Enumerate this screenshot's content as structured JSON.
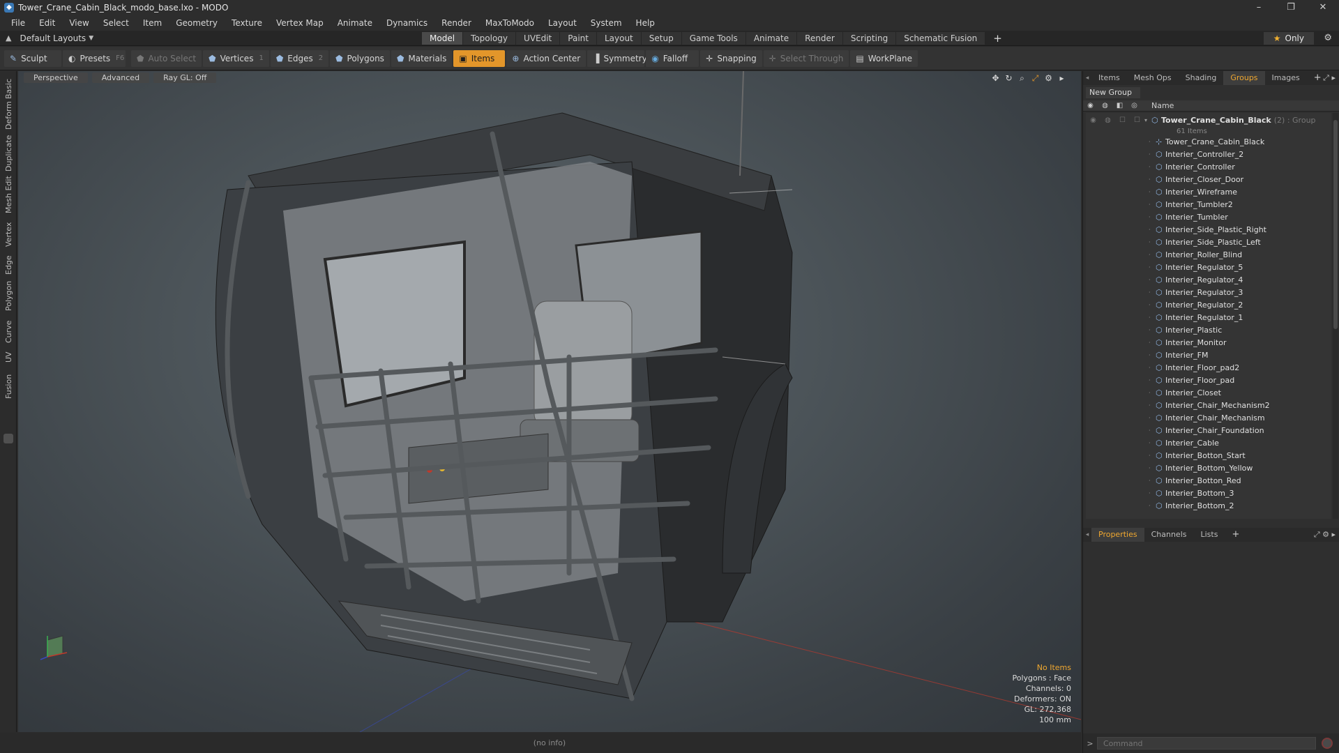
{
  "window": {
    "title": "Tower_Crane_Cabin_Black_modo_base.lxo - MODO",
    "controls": [
      "–",
      "❐",
      "✕"
    ]
  },
  "menu": [
    "File",
    "Edit",
    "View",
    "Select",
    "Item",
    "Geometry",
    "Texture",
    "Vertex Map",
    "Animate",
    "Dynamics",
    "Render",
    "MaxToModo",
    "Layout",
    "System",
    "Help"
  ],
  "layout": {
    "selector": "Default Layouts",
    "tabs": [
      "Model",
      "Topology",
      "UVEdit",
      "Paint",
      "Layout",
      "Setup",
      "Game Tools",
      "Animate",
      "Render",
      "Scripting",
      "Schematic Fusion"
    ],
    "active_tab": "Model",
    "only_label": "Only"
  },
  "toolbar": {
    "sculpt": "Sculpt",
    "presets": "Presets",
    "presets_key": "F6",
    "auto_select": "Auto Select",
    "vertices": "Vertices",
    "vertices_key": "1",
    "edges": "Edges",
    "edges_key": "2",
    "polygons": "Polygons",
    "materials": "Materials",
    "items": "Items",
    "action_center": "Action Center",
    "symmetry": "Symmetry",
    "falloff": "Falloff",
    "snapping": "Snapping",
    "select_through": "Select Through",
    "workplane": "WorkPlane"
  },
  "left_tabs": [
    "Basic",
    "Deform",
    "Duplicate",
    "Mesh Edit",
    "Vertex",
    "Edge",
    "Polygon",
    "Curve",
    "UV",
    "Fusion"
  ],
  "viewport": {
    "view": "Perspective",
    "shading": "Advanced",
    "raygl": "Ray GL: Off",
    "info": {
      "selection": "No Items",
      "polygons": "Polygons : Face",
      "channels": "Channels: 0",
      "deformers": "Deformers: ON",
      "gl": "GL: 272,368",
      "scale": "100 mm"
    }
  },
  "status": "(no info)",
  "right_tabs": {
    "top": [
      "Items",
      "Mesh Ops",
      "Shading",
      "Groups",
      "Images"
    ],
    "top_active": "Groups",
    "bottom": [
      "Properties",
      "Channels",
      "Lists"
    ],
    "bottom_active": "Properties"
  },
  "groups": {
    "new_group": "New Group",
    "name_header": "Name",
    "root": {
      "name": "Tower_Crane_Cabin_Black",
      "count": "(2) : Group",
      "sub": "61 Items"
    },
    "items": [
      "Tower_Crane_Cabin_Black",
      "Interier_Controller_2",
      "Interier_Controller",
      "Interier_Closer_Door",
      "Interier_Wireframe",
      "Interier_Tumbler2",
      "Interier_Tumbler",
      "Interier_Side_Plastic_Right",
      "Interier_Side_Plastic_Left",
      "Interier_Roller_Blind",
      "Interier_Regulator_5",
      "Interier_Regulator_4",
      "Interier_Regulator_3",
      "Interier_Regulator_2",
      "Interier_Regulator_1",
      "Interier_Plastic",
      "Interier_Monitor",
      "Interier_FM",
      "Interier_Floor_pad2",
      "Interier_Floor_pad",
      "Interier_Closet",
      "Interier_Chair_Mechanism2",
      "Interier_Chair_Mechanism",
      "Interier_Chair_Foundation",
      "Interier_Cable",
      "Interier_Botton_Start",
      "Interier_Bottom_Yellow",
      "Interier_Botton_Red",
      "Interier_Bottom_3",
      "Interier_Bottom_2"
    ]
  },
  "command": {
    "placeholder": "Command"
  },
  "colors": {
    "accent": "#e3962a",
    "active_tab_text": "#f0a830",
    "viewport": "#4b5358"
  }
}
